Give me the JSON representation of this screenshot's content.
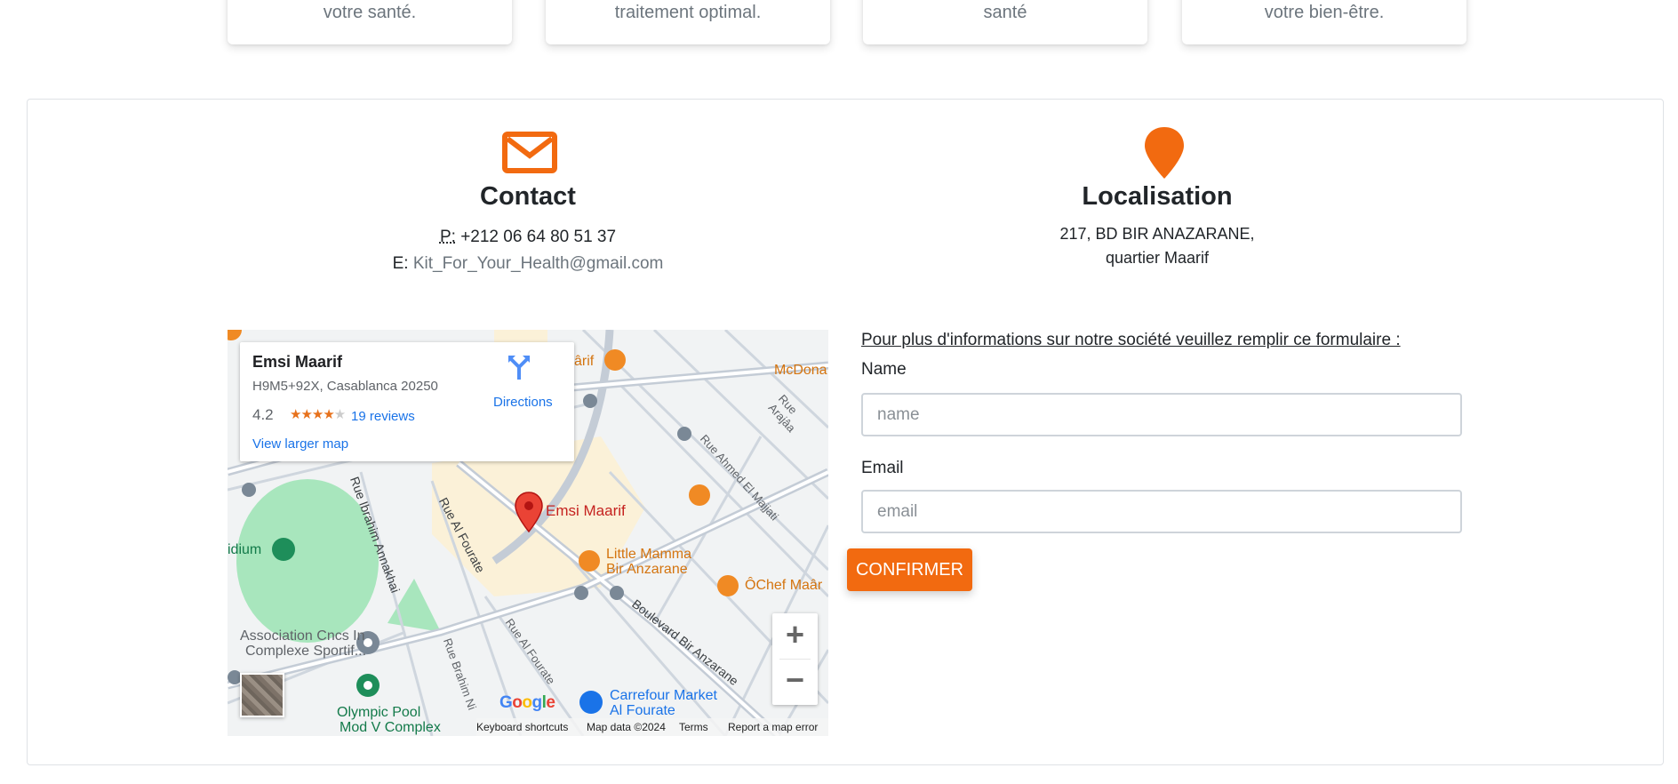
{
  "cards": [
    {
      "text": "votre santé."
    },
    {
      "text": "traitement optimal."
    },
    {
      "text": "santé"
    },
    {
      "text": "votre bien-être."
    }
  ],
  "contact": {
    "icon": "envelope-icon",
    "title": "Contact",
    "phone_abbr": "P:",
    "phone": "+212 06 64 80 51 37",
    "email_label": "E:",
    "email": "Kit_For_Your_Health@gmail.com"
  },
  "location": {
    "icon": "map-pin-icon",
    "title": "Localisation",
    "address_line1": "217, BD BIR ANAZARANE,",
    "address_line2": "quartier Maarif"
  },
  "map": {
    "place_name": "Emsi Maarif",
    "place_address": "H9M5+92X, Casablanca 20250",
    "rating": "4.2",
    "stars": 4,
    "reviews": "19 reviews",
    "directions": "Directions",
    "view_larger": "View larger map",
    "marker_label": "Emsi Maarif",
    "labels": {
      "mcdonalds": "McDona",
      "arif": "ârif",
      "idium": "idium",
      "little_mamma_1": "Little Mamma",
      "little_mamma_2": "Bir Anzarane",
      "ochef": "ÔChef Maâr",
      "assoc_1": "Association Cncs In",
      "assoc_2": "Complexe Sportif...",
      "olympic_1": "Olympic Pool",
      "olympic_2": "Mod V Complex",
      "carrefour_1": "Carrefour Market",
      "carrefour_2": "Al Fourate",
      "street_ahmed": "Rue Ahmed El Majjati",
      "street_araja": "Rue Arajâa",
      "street_ibrahim": "Rue Ibrahim Annakhai",
      "street_fourate": "Rue Al Fourate",
      "street_fourate2": "Rue Al Fourate",
      "street_brahim": "Rue Brahim Ni",
      "street_boulevard": "Boulevard Bir Anzarane"
    },
    "google": "Google",
    "attribution": {
      "shortcuts": "Keyboard shortcuts",
      "data": "Map data ©2024",
      "terms": "Terms",
      "report": "Report a map error"
    }
  },
  "form": {
    "intro": "Pour plus d'informations sur notre société veuillez remplir ce formulaire :",
    "name_label": "Name",
    "name_placeholder": "name",
    "email_label": "Email",
    "email_placeholder": "email",
    "submit": "CONFIRMER"
  },
  "colors": {
    "accent": "#f26a10",
    "marker": "#ea4335",
    "poi_orange": "#f08a24",
    "link_blue": "#1a73e8"
  }
}
